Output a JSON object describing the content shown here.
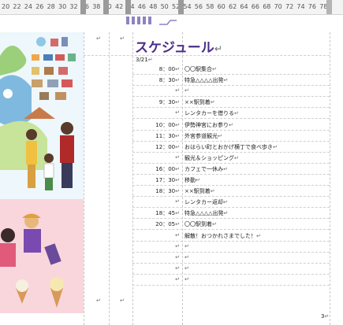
{
  "ruler": {
    "numbers": [
      "20",
      "22",
      "24",
      "26",
      "28",
      "30",
      "32",
      "36",
      "38",
      "40",
      "42",
      "44",
      "46",
      "48",
      "50",
      "52",
      "54",
      "56",
      "58",
      "60",
      "62",
      "64",
      "66",
      "68",
      "70",
      "72",
      "74",
      "76",
      "78"
    ]
  },
  "document": {
    "title": "スケジュール",
    "date": "3/21",
    "return_mark": "↵",
    "page_number": "3",
    "rows": [
      {
        "time": "8：00",
        "activity": "〇〇駅集合"
      },
      {
        "time": "8：30",
        "activity": "特急△△△△出発"
      },
      {
        "time": "",
        "activity": ""
      },
      {
        "time": "9：30",
        "activity": "××駅到着"
      },
      {
        "time": "",
        "activity": "レンタカーを借りる"
      },
      {
        "time": "10：00",
        "activity": "伊勢神宮にお参り"
      },
      {
        "time": "11：30",
        "activity": "外宮参道観光"
      },
      {
        "time": "12：00",
        "activity": "おはらい町とおかげ横丁で食べ歩き"
      },
      {
        "time": "",
        "activity": "観光＆ショッピング"
      },
      {
        "time": "16：00",
        "activity": "カフェで一休み"
      },
      {
        "time": "17：30",
        "activity": "移動"
      },
      {
        "time": "18：30",
        "activity": "××駅到着"
      },
      {
        "time": "",
        "activity": "レンタカー返却"
      },
      {
        "time": "18：45",
        "activity": "特急△△△△出発"
      },
      {
        "time": "20：05",
        "activity": "〇〇駅到着"
      },
      {
        "time": "",
        "activity": "解散！おつかれさまでした！"
      },
      {
        "time": "",
        "activity": ""
      },
      {
        "time": "",
        "activity": ""
      },
      {
        "time": "",
        "activity": ""
      },
      {
        "time": "",
        "activity": ""
      }
    ]
  },
  "colors": {
    "title": "#4b2f8a",
    "illus_top": "#dff1f7",
    "illus_bottom": "#f9d6dc",
    "ruler_bg": "#f3f3f3"
  }
}
